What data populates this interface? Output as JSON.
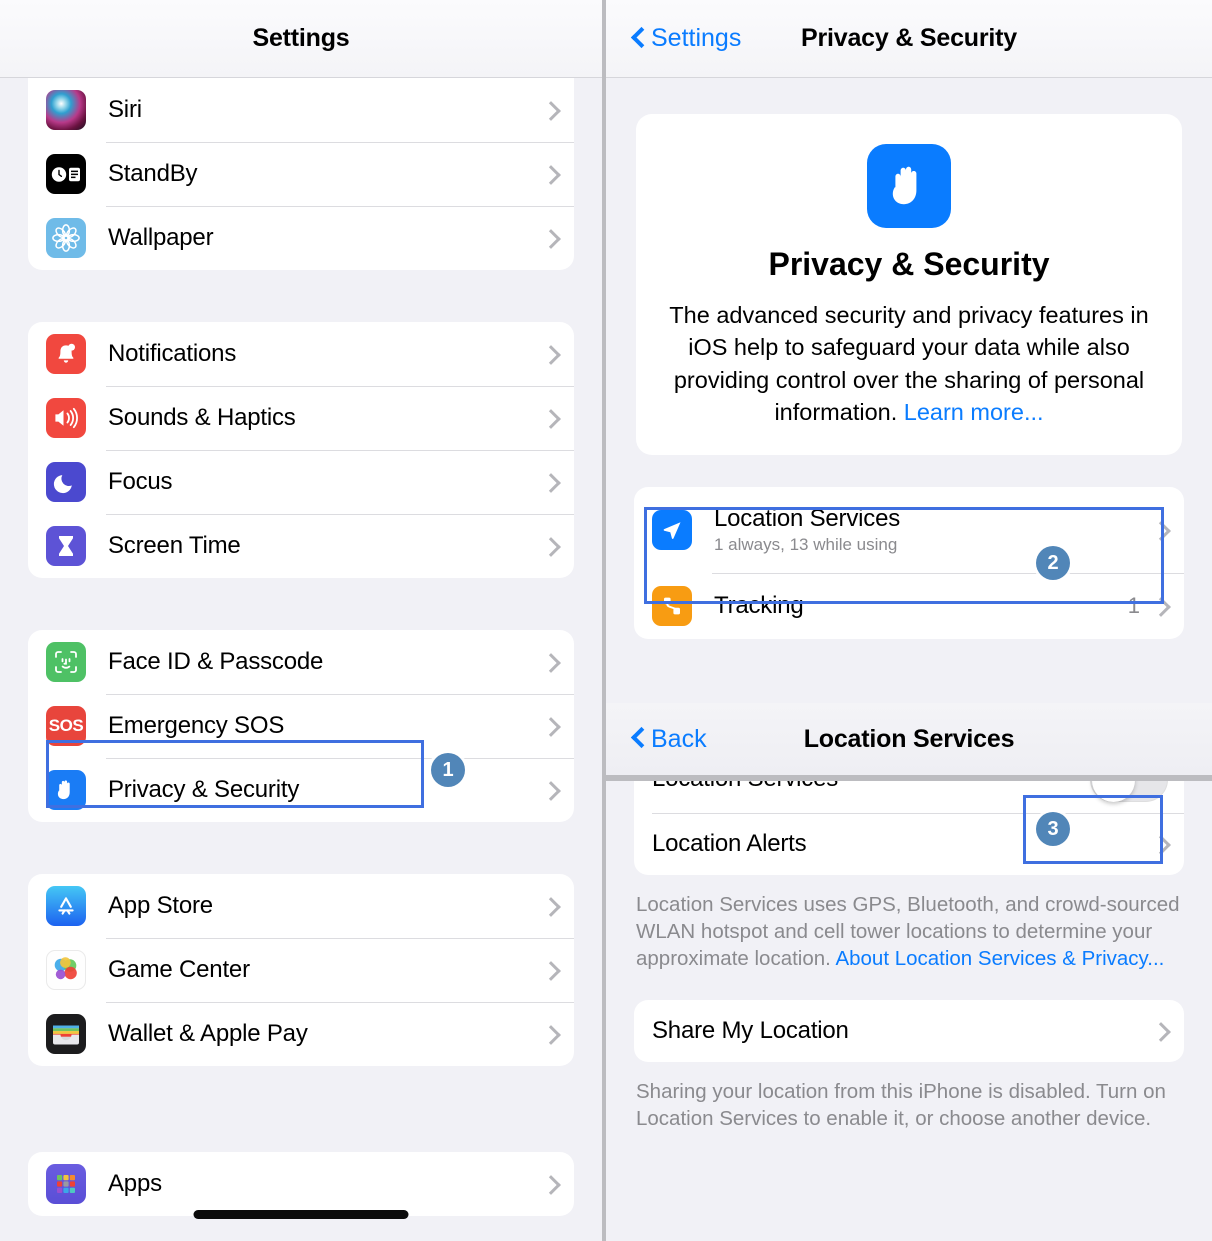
{
  "colors": {
    "accent_blue": "#0a7cff",
    "annotation_border": "#3f6fe0",
    "badge_fill": "#5186b8",
    "page_bg": "#f1f1f6",
    "card_bg": "#ffffff",
    "secondary_text": "#8a8a8e"
  },
  "left_panel": {
    "navbar": {
      "title": "Settings"
    },
    "groups": [
      {
        "id": "group-siri",
        "rows": [
          {
            "label": "Siri",
            "icon": "siri-icon",
            "accessory": "chevron"
          },
          {
            "label": "StandBy",
            "icon": "standby-icon",
            "accessory": "chevron"
          },
          {
            "label": "Wallpaper",
            "icon": "wallpaper-icon",
            "accessory": "chevron"
          }
        ]
      },
      {
        "id": "group-notifications",
        "rows": [
          {
            "label": "Notifications",
            "icon": "notifications-icon",
            "accessory": "chevron"
          },
          {
            "label": "Sounds & Haptics",
            "icon": "sounds-icon",
            "accessory": "chevron"
          },
          {
            "label": "Focus",
            "icon": "focus-icon",
            "accessory": "chevron"
          },
          {
            "label": "Screen Time",
            "icon": "screen-time-icon",
            "accessory": "chevron"
          }
        ]
      },
      {
        "id": "group-security",
        "rows": [
          {
            "label": "Face ID & Passcode",
            "icon": "face-id-icon",
            "accessory": "chevron"
          },
          {
            "label": "Emergency SOS",
            "icon": "sos-icon",
            "accessory": "chevron"
          },
          {
            "label": "Privacy & Security",
            "icon": "privacy-hand-icon",
            "accessory": "chevron"
          }
        ]
      },
      {
        "id": "group-store",
        "rows": [
          {
            "label": "App Store",
            "icon": "app-store-icon",
            "accessory": "chevron"
          },
          {
            "label": "Game Center",
            "icon": "game-center-icon",
            "accessory": "chevron"
          },
          {
            "label": "Wallet & Apple Pay",
            "icon": "wallet-icon",
            "accessory": "chevron"
          }
        ]
      },
      {
        "id": "group-apps",
        "rows": [
          {
            "label": "Apps",
            "icon": "apps-icon",
            "accessory": "chevron"
          }
        ]
      }
    ]
  },
  "right_panel_top": {
    "navbar": {
      "back_label": "Settings",
      "title": "Privacy & Security"
    },
    "hero": {
      "icon": "privacy-hand-icon",
      "title": "Privacy & Security",
      "body": "The advanced security and privacy features in iOS help to safeguard your data while also providing control over the sharing of personal information. ",
      "link": "Learn more..."
    },
    "rows": [
      {
        "label": "Location Services",
        "subtitle": "1 always, 13 while using",
        "icon": "location-arrow-icon",
        "value": "",
        "accessory": "chevron"
      },
      {
        "label": "Tracking",
        "subtitle": "",
        "icon": "tracking-icon",
        "value": "1",
        "accessory": "chevron"
      }
    ]
  },
  "right_panel_bottom": {
    "navbar": {
      "back_label": "Back",
      "title": "Location Services"
    },
    "rows": [
      {
        "label": "Location Services",
        "accessory": "toggle",
        "toggle_on": false
      },
      {
        "label": "Location Alerts",
        "accessory": "chevron"
      }
    ],
    "footer_1": {
      "text": "Location Services uses GPS, Bluetooth, and crowd-sourced WLAN hotspot and cell tower locations to determine your approximate location. ",
      "link": "About Location Services & Privacy..."
    },
    "share_row": {
      "label": "Share My Location",
      "accessory": "chevron"
    },
    "footer_2": {
      "text": "Sharing your location from this iPhone is disabled. Turn on Location Services to enable it, or choose another device."
    }
  },
  "annotations": [
    {
      "id": "step-1",
      "number": "1",
      "target": "Privacy & Security row in Settings list"
    },
    {
      "id": "step-2",
      "number": "2",
      "target": "Location Services row in Privacy & Security"
    },
    {
      "id": "step-3",
      "number": "3",
      "target": "Location Services toggle switch"
    }
  ]
}
